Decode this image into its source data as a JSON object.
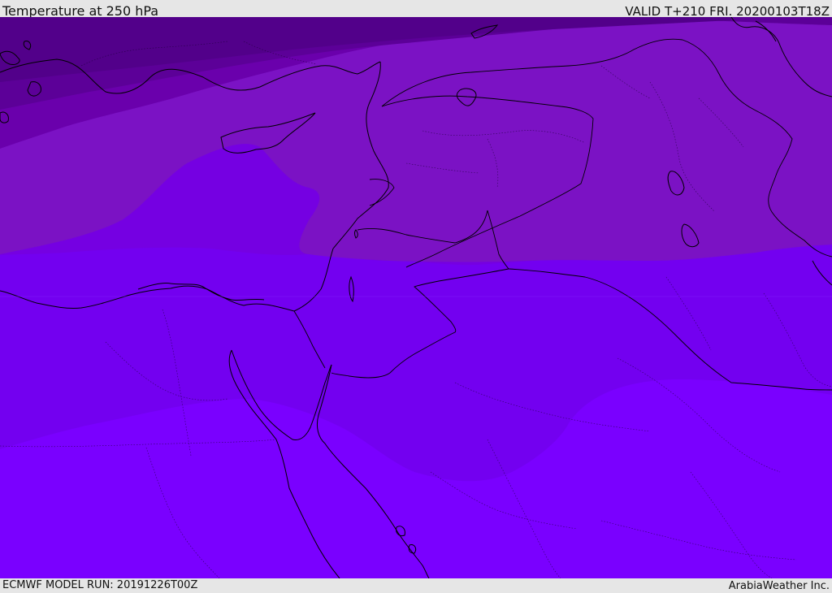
{
  "header": {
    "title": "Temperature at 250 hPa",
    "valid": "VALID T+210 FRI. 20200103T18Z"
  },
  "footer": {
    "model_run": "ECMWF MODEL RUN: 20191226T00Z",
    "credit": "ArabiaWeather Inc."
  },
  "map": {
    "field": "temperature",
    "level": "250 hPa",
    "region": "Eastern Mediterranean / Middle East",
    "shading_colors": [
      "#5a0096",
      "#6a00ac",
      "#7a10bf",
      "#7400dc",
      "#7a00f0",
      "#7a00ff"
    ]
  }
}
